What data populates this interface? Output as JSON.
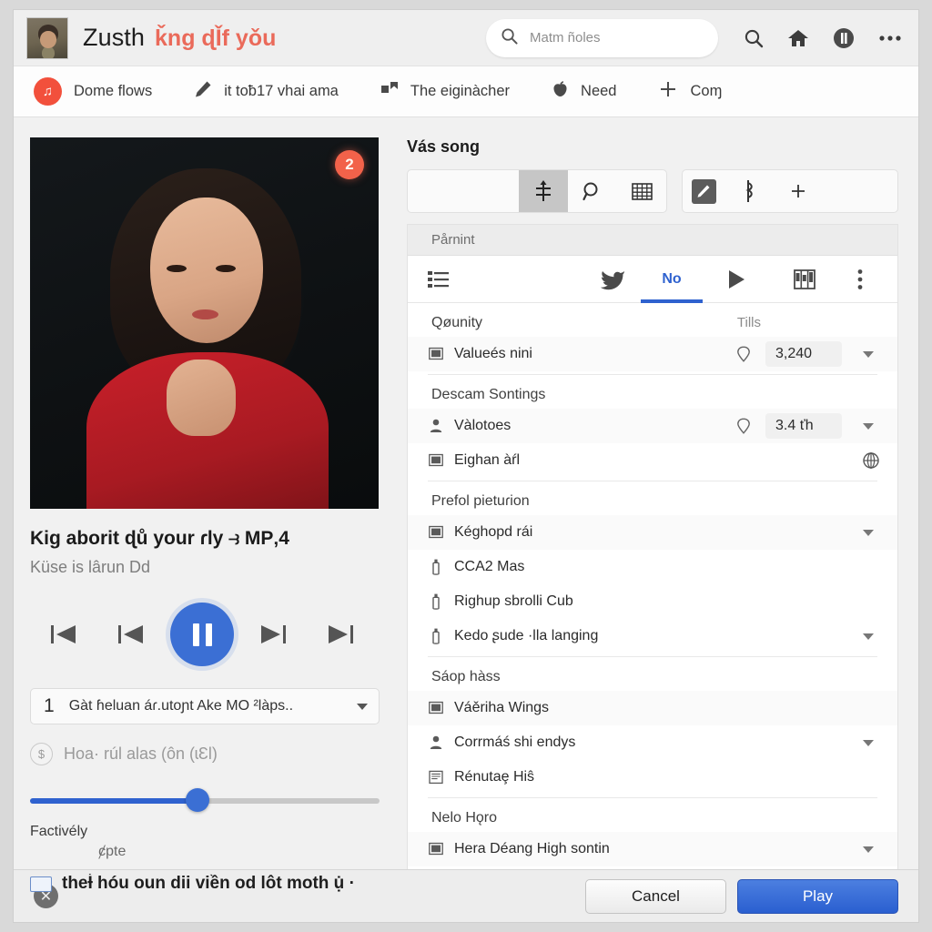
{
  "topbar": {
    "avatar_name": "user-avatar",
    "brand_main": "Zusth",
    "brand_sub": "ǩng ɖǏf yǒu",
    "search_placeholder": "Matm ñoles",
    "search_value": "",
    "icons": [
      "search-icon",
      "home-icon",
      "pause-circle-icon",
      "more-horizontal-icon"
    ]
  },
  "nav": {
    "items": [
      {
        "label": "Dome flows",
        "icon": "music-note-badge-icon"
      },
      {
        "label": "it toƀ17 vhai ama",
        "icon": "pencil-icon"
      },
      {
        "label": "The eiginàcher",
        "icon": "share-arrow-icon"
      },
      {
        "label": "Need",
        "icon": "apple-icon"
      },
      {
        "label": "Coɱ",
        "icon": "plus-icon"
      }
    ]
  },
  "media": {
    "badge": "2",
    "title": "Kig aborit ɖů your ɾly ⥽ MP‚4",
    "subtitle": "Küse is lârun Dd",
    "transport": [
      "skip-back-icon",
      "previous-icon",
      "pause-icon",
      "next-icon",
      "skip-forward-icon"
    ],
    "select": {
      "number": "1",
      "text": "Gàt ɦeluan áɾ.utoɲt Ake MO ²làps..",
      "caret": "chevron-down-icon"
    },
    "cost": {
      "coin": "$",
      "text": "Hoa· rúl alas (ôn (ɩƐl)"
    },
    "slider": {
      "percent": 48,
      "left_label": "Factivély",
      "right_label": "ȼpte"
    },
    "checkrow": {
      "text": "theƗ́ hóu oun dii viền od lôt moth ụ̇ ·"
    }
  },
  "panel": {
    "title": "Vás song",
    "toolbar_left": [
      "align-center-icon",
      "search-icon",
      "grid-icon"
    ],
    "toolbar_right": [
      "pen-box-icon",
      "note-icon",
      "plus-icon"
    ],
    "subhead": "Pårnint",
    "tabs": [
      {
        "label": "",
        "icon": "list-icon",
        "active": false
      },
      {
        "label": "",
        "icon": "bird-icon",
        "active": false
      },
      {
        "label": "No",
        "icon": "",
        "active": true
      },
      {
        "label": "",
        "icon": "play-icon",
        "active": false
      },
      {
        "label": "",
        "icon": "columns-icon",
        "active": false
      },
      {
        "label": "",
        "icon": "more-vertical-icon",
        "active": false
      }
    ],
    "column_header": "Tills",
    "groups": [
      {
        "label": "Qøunity",
        "rows": [
          {
            "icon": "monitor-icon",
            "label": "Valueés nini",
            "pin": "pin-icon",
            "value": "3,240",
            "dropdown": true,
            "shaded": true,
            "globe": false
          }
        ]
      },
      {
        "label": "Descam Sontings",
        "rows": [
          {
            "icon": "person-icon",
            "label": "Vàlotoes",
            "pin": "pin-icon",
            "value": "3.4 ťh",
            "dropdown": true,
            "shaded": true,
            "globe": false
          },
          {
            "icon": "monitor-icon",
            "label": "Eighan àŕl",
            "pin": "",
            "value": "",
            "dropdown": false,
            "shaded": false,
            "globe": true
          }
        ]
      },
      {
        "label": "Prefol pietuɾion",
        "rows": [
          {
            "icon": "monitor-icon",
            "label": "Kéghopd rái",
            "pin": "",
            "value": "",
            "dropdown": true,
            "shaded": true,
            "globe": false
          },
          {
            "icon": "bottle-icon",
            "label": "CCA2 Mas",
            "pin": "",
            "value": "",
            "dropdown": false,
            "shaded": false,
            "globe": false
          },
          {
            "icon": "bottle-icon",
            "label": "Righup sbrolli Cub",
            "pin": "",
            "value": "",
            "dropdown": false,
            "shaded": false,
            "globe": false
          },
          {
            "icon": "bottle-icon",
            "label": "Kedo ʂude ·lla langing",
            "pin": "",
            "value": "",
            "dropdown": true,
            "shaded": false,
            "globe": false
          }
        ]
      },
      {
        "label": "Sáop hàss",
        "rows": [
          {
            "icon": "monitor-icon",
            "label": "Váěriha Wings",
            "pin": "",
            "value": "",
            "dropdown": false,
            "shaded": true,
            "globe": false
          },
          {
            "icon": "person-icon",
            "label": "Corrmáś shi endys",
            "pin": "",
            "value": "",
            "dropdown": true,
            "shaded": false,
            "globe": false
          },
          {
            "icon": "book-icon",
            "label": "Rénutaȩ Hiŝ",
            "pin": "",
            "value": "",
            "dropdown": false,
            "shaded": false,
            "globe": false
          }
        ]
      },
      {
        "label": "Nelo Hǫro",
        "rows": [
          {
            "icon": "monitor-icon",
            "label": "Hera Déang High sontin",
            "pin": "",
            "value": "",
            "dropdown": true,
            "shaded": true,
            "globe": false
          }
        ]
      }
    ]
  },
  "footer": {
    "close_icon": "close-circle-icon",
    "cancel_label": "Cancel",
    "play_label": "Play"
  },
  "colors": {
    "accent_blue": "#2f62cf",
    "brand_red": "#ea6a5a",
    "badge_red": "#f2624a",
    "play_button": "#3b6fd4"
  }
}
